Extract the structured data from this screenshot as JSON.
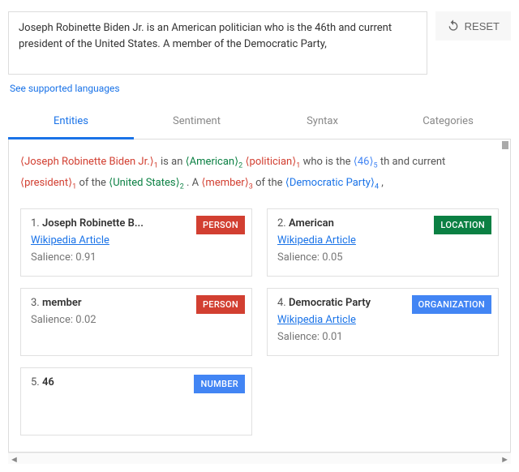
{
  "input_text": "Joseph Robinette Biden Jr. is an American politician who is the 46th and current president of the United States. A member of the Democratic Party,",
  "reset_label": "RESET",
  "supported_langs": "See supported languages",
  "tabs": {
    "entities": "Entities",
    "sentiment": "Sentiment",
    "syntax": "Syntax",
    "categories": "Categories"
  },
  "sentence_parts": [
    {
      "t": "⟨",
      "cls": "person"
    },
    {
      "t": "Joseph Robinette Biden Jr.",
      "cls": "person"
    },
    {
      "t": "⟩",
      "cls": "person"
    },
    {
      "sub": "1",
      "cls": "person"
    },
    {
      "t": " is an "
    },
    {
      "t": "⟨",
      "cls": "location"
    },
    {
      "t": "American",
      "cls": "location"
    },
    {
      "t": "⟩",
      "cls": "location"
    },
    {
      "sub": "2",
      "cls": "location"
    },
    {
      "t": " "
    },
    {
      "t": "⟨",
      "cls": "person"
    },
    {
      "t": "politician",
      "cls": "person"
    },
    {
      "t": "⟩",
      "cls": "person"
    },
    {
      "sub": "1",
      "cls": "person"
    },
    {
      "t": " who is the "
    },
    {
      "t": "⟨",
      "cls": "number"
    },
    {
      "t": "46",
      "cls": "number"
    },
    {
      "t": "⟩",
      "cls": "number"
    },
    {
      "sub": "5",
      "cls": "number"
    },
    {
      "t": " th and current "
    },
    {
      "t": "⟨",
      "cls": "person"
    },
    {
      "t": "president",
      "cls": "person"
    },
    {
      "t": "⟩",
      "cls": "person"
    },
    {
      "sub": "1",
      "cls": "person"
    },
    {
      "t": " of the "
    },
    {
      "t": "⟨",
      "cls": "location"
    },
    {
      "t": "United States",
      "cls": "location"
    },
    {
      "t": "⟩",
      "cls": "location"
    },
    {
      "sub": "2",
      "cls": "location"
    },
    {
      "t": " . A "
    },
    {
      "t": "⟨",
      "cls": "person"
    },
    {
      "t": "member",
      "cls": "person"
    },
    {
      "t": "⟩",
      "cls": "person"
    },
    {
      "sub": "3",
      "cls": "person"
    },
    {
      "t": " of the "
    },
    {
      "t": "⟨",
      "cls": "organization"
    },
    {
      "t": "Democratic Party",
      "cls": "organization"
    },
    {
      "t": "⟩",
      "cls": "organization"
    },
    {
      "sub": "4",
      "cls": "organization"
    },
    {
      "t": " ,"
    }
  ],
  "wiki_label": "Wikipedia Article",
  "salience_label": "Salience:",
  "entities": [
    {
      "n": "1",
      "name": "Joseph Robinette B...",
      "type": "PERSON",
      "type_key": "person",
      "wiki": true,
      "salience": "0.91"
    },
    {
      "n": "2",
      "name": "American",
      "type": "LOCATION",
      "type_key": "location",
      "wiki": true,
      "salience": "0.05"
    },
    {
      "n": "3",
      "name": "member",
      "type": "PERSON",
      "type_key": "person",
      "wiki": false,
      "salience": "0.02"
    },
    {
      "n": "4",
      "name": "Democratic Party",
      "type": "ORGANIZATION",
      "type_key": "organization",
      "wiki": true,
      "salience": "0.01"
    },
    {
      "n": "5",
      "name": "46",
      "type": "NUMBER",
      "type_key": "number",
      "wiki": false,
      "salience": null
    }
  ]
}
